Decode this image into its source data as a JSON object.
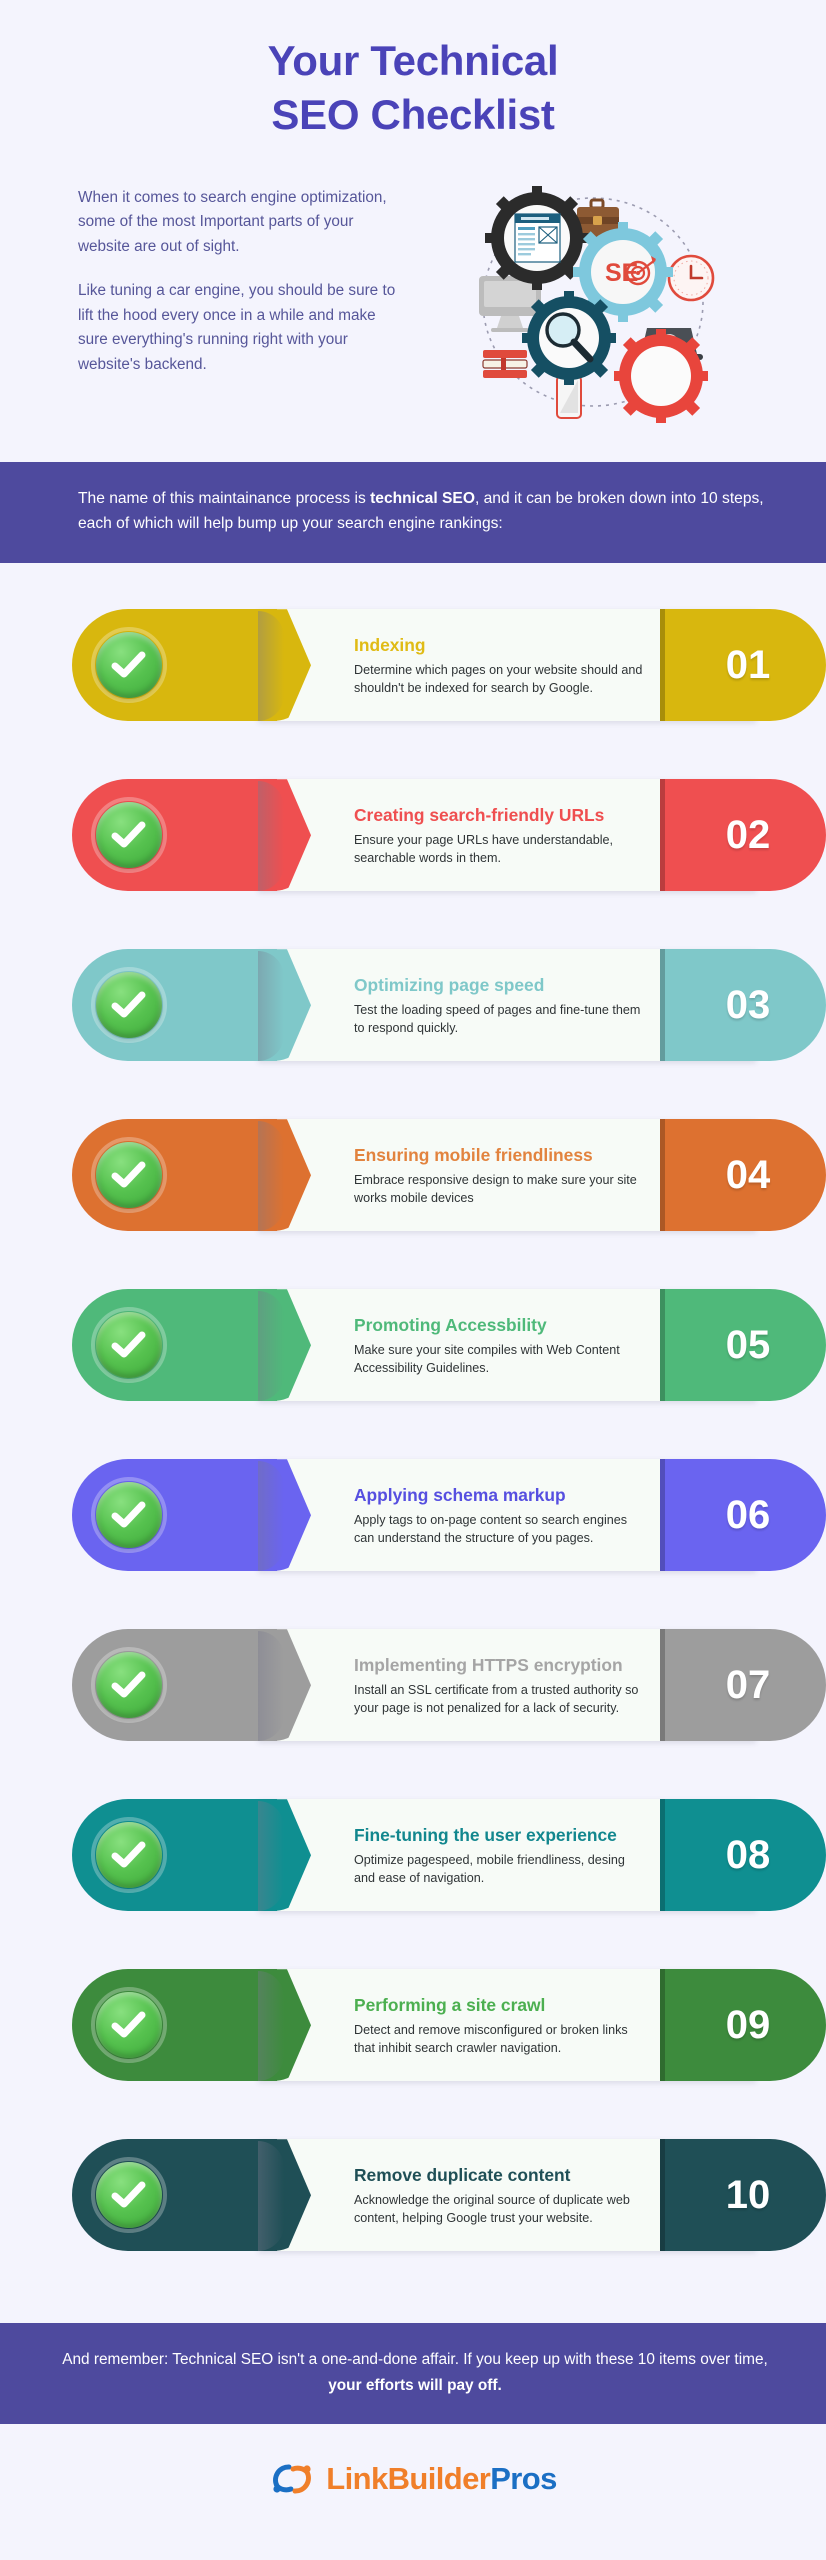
{
  "hero": {
    "title_line1": "Your Technical",
    "title_line2": "SEO Checklist",
    "paragraph1": "When it comes to search engine optimization, some of the most Important parts of your website are out of sight.",
    "paragraph2": "Like tuning a car engine, you should be sure to lift the hood every once in a while and make sure everything's running right with your website's backend.",
    "illustration_alt": "seo-gears-illustration",
    "illustration_label": "SEO"
  },
  "banner": {
    "text_before": "The name of this maintainance process is ",
    "emphasis": "technical SEO",
    "text_after": ", and it can be broken down into 10 steps, each of which will help bump up your search engine rankings:"
  },
  "steps": [
    {
      "number": "01",
      "title": "Indexing",
      "description": "Determine which pages on your website should and shouldn't be indexed for search by Google.",
      "color": "#d8b70e",
      "title_color": "#e0bb15"
    },
    {
      "number": "02",
      "title": "Creating search-friendly URLs",
      "description": "Ensure your page URLs have understandable, searchable words in them.",
      "color": "#ef4f50",
      "title_color": "#ef4f50"
    },
    {
      "number": "03",
      "title": "Optimizing page speed",
      "description": "Test the loading speed of pages and fine-tune them to respond quickly.",
      "color": "#7fc8c9",
      "title_color": "#7fc8c9"
    },
    {
      "number": "04",
      "title": "Ensuring mobile friendliness",
      "description": "Embrace responsive design to make sure your site works mobile devices",
      "color": "#dd7130",
      "title_color": "#e2833e"
    },
    {
      "number": "05",
      "title": "Promoting Accessbility",
      "description": "Make sure your site compiles with Web Content Accessibility Guidelines.",
      "color": "#4fb97a",
      "title_color": "#4fb97a"
    },
    {
      "number": "06",
      "title": "Applying schema markup",
      "description": "Apply tags to on-page content so search engines can understand the structure of you pages.",
      "color": "#6a64f0",
      "title_color": "#564fe0"
    },
    {
      "number": "07",
      "title": "Implementing HTTPS encryption",
      "description": "Install an SSL certificate from a trusted authority so your page is not penalized for a lack of security.",
      "color": "#9d9d9d",
      "title_color": "#a5a5a5"
    },
    {
      "number": "08",
      "title": "Fine-tuning the user experience",
      "description": "Optimize pagespeed, mobile friendliness, desing and ease of navigation.",
      "color": "#0f8f91",
      "title_color": "#12878e"
    },
    {
      "number": "09",
      "title": "Performing a site crawl",
      "description": "Detect and remove misconfigured or broken links that inhibit search crawler navigation.",
      "color": "#3d8b3d",
      "title_color": "#4caf50"
    },
    {
      "number": "10",
      "title": "Remove duplicate content",
      "description": "Acknowledge the original source of duplicate web content, helping Google trust your website.",
      "color": "#1f4f56",
      "title_color": "#1f4f56"
    }
  ],
  "footer": {
    "text_before": "And remember: Technical SEO isn't a one-and-done affair. If you keep up with these 10 items over time, ",
    "emphasis": "your efforts will pay off.",
    "logo_part1": "LinkBuilder",
    "logo_part2": "Pros"
  },
  "colors": {
    "page_bg": "#f4f4fd",
    "brand_purple": "#4a43b8",
    "banner_purple": "#4e4a9e",
    "body_text": "#565699",
    "logo_orange": "#f07f2a",
    "logo_blue": "#1b6fc4"
  }
}
